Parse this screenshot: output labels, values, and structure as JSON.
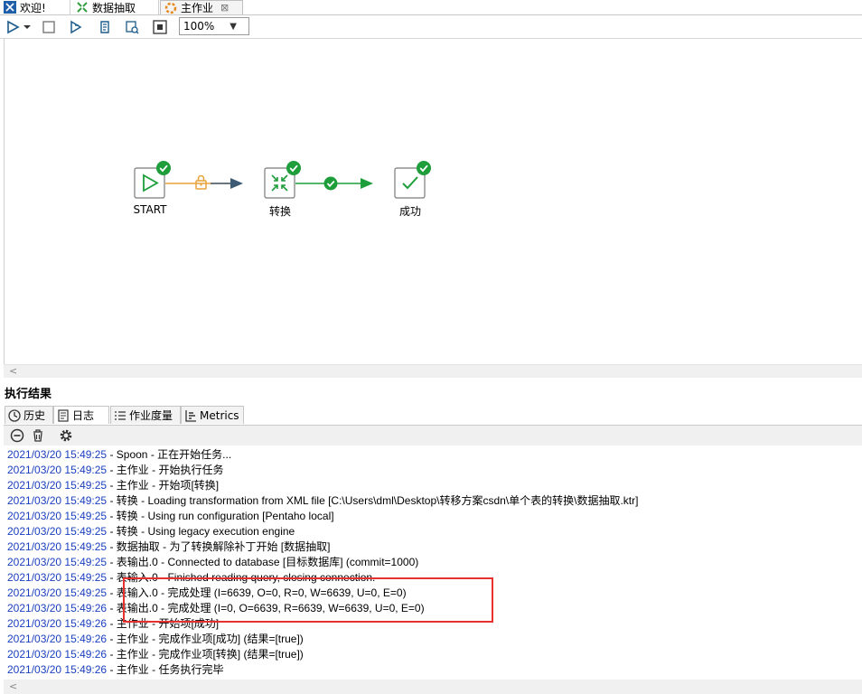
{
  "tabs": [
    {
      "label": "欢迎!",
      "icon": "welcome-icon"
    },
    {
      "label": "数据抽取",
      "icon": "transformation-icon"
    },
    {
      "label": "主作业",
      "icon": "job-icon",
      "active": true,
      "close": "⊠"
    }
  ],
  "toolbar": {
    "zoom": "100%",
    "buttons": [
      "run-icon",
      "run-dropdown-icon",
      "stop-icon",
      "replay-icon",
      "script-icon",
      "check-icon",
      "layout-icon"
    ]
  },
  "job": {
    "nodes": [
      {
        "id": "start",
        "label": "START",
        "icon": "start-play-icon",
        "status": "success"
      },
      {
        "id": "transform",
        "label": "转换",
        "icon": "transform-icon",
        "status": "success"
      },
      {
        "id": "success",
        "label": "成功",
        "icon": "checkmark-icon",
        "status": "success"
      }
    ],
    "hops": [
      {
        "from": "start",
        "to": "transform",
        "condition": "unconditional",
        "color": "#3c5a73"
      },
      {
        "from": "transform",
        "to": "success",
        "condition": "on-success",
        "color": "#1e9e3a"
      }
    ]
  },
  "results": {
    "title": "执行结果",
    "tabs": [
      {
        "label": "历史",
        "icon": "history-icon"
      },
      {
        "label": "日志",
        "icon": "log-icon",
        "active": true
      },
      {
        "label": "作业度量",
        "icon": "metrics-list-icon"
      },
      {
        "label": "Metrics",
        "icon": "metrics-chart-icon"
      }
    ],
    "log_toolbar": [
      "clear-log-icon",
      "delete-icon",
      "settings-icon"
    ],
    "log": [
      {
        "ts": "2021/03/20 15:49:25",
        "msg": "Spoon - 正在开始任务..."
      },
      {
        "ts": "2021/03/20 15:49:25",
        "msg": "主作业 - 开始执行任务"
      },
      {
        "ts": "2021/03/20 15:49:25",
        "msg": "主作业 - 开始项[转换]"
      },
      {
        "ts": "2021/03/20 15:49:25",
        "msg": "转换 - Loading transformation from XML file [C:\\Users\\dml\\Desktop\\转移方案csdn\\单个表的转换\\数据抽取.ktr]"
      },
      {
        "ts": "2021/03/20 15:49:25",
        "msg": "转换 - Using run configuration [Pentaho local]"
      },
      {
        "ts": "2021/03/20 15:49:25",
        "msg": "转换 - Using legacy execution engine"
      },
      {
        "ts": "2021/03/20 15:49:25",
        "msg": "数据抽取 - 为了转换解除补丁开始  [数据抽取]"
      },
      {
        "ts": "2021/03/20 15:49:25",
        "msg": "表输出.0 - Connected to database [目标数据库] (commit=1000)"
      },
      {
        "ts": "2021/03/20 15:49:25",
        "msg": "表输入.0 - Finished reading query, closing connection."
      },
      {
        "ts": "2021/03/20 15:49:25",
        "msg": "表输入.0 - 完成处理 (I=6639, O=0, R=0, W=6639, U=0, E=0)"
      },
      {
        "ts": "2021/03/20 15:49:26",
        "msg": "表输出.0 - 完成处理 (I=0, O=6639, R=6639, W=6639, U=0, E=0)"
      },
      {
        "ts": "2021/03/20 15:49:26",
        "msg": "主作业 - 开始项[成功]"
      },
      {
        "ts": "2021/03/20 15:49:26",
        "msg": "主作业 - 完成作业项[成功] (结果=[true])"
      },
      {
        "ts": "2021/03/20 15:49:26",
        "msg": "主作业 - 完成作业项[转换] (结果=[true])"
      },
      {
        "ts": "2021/03/20 15:49:26",
        "msg": "主作业 - 任务执行完毕"
      }
    ],
    "highlight_color": "#e8312f"
  }
}
